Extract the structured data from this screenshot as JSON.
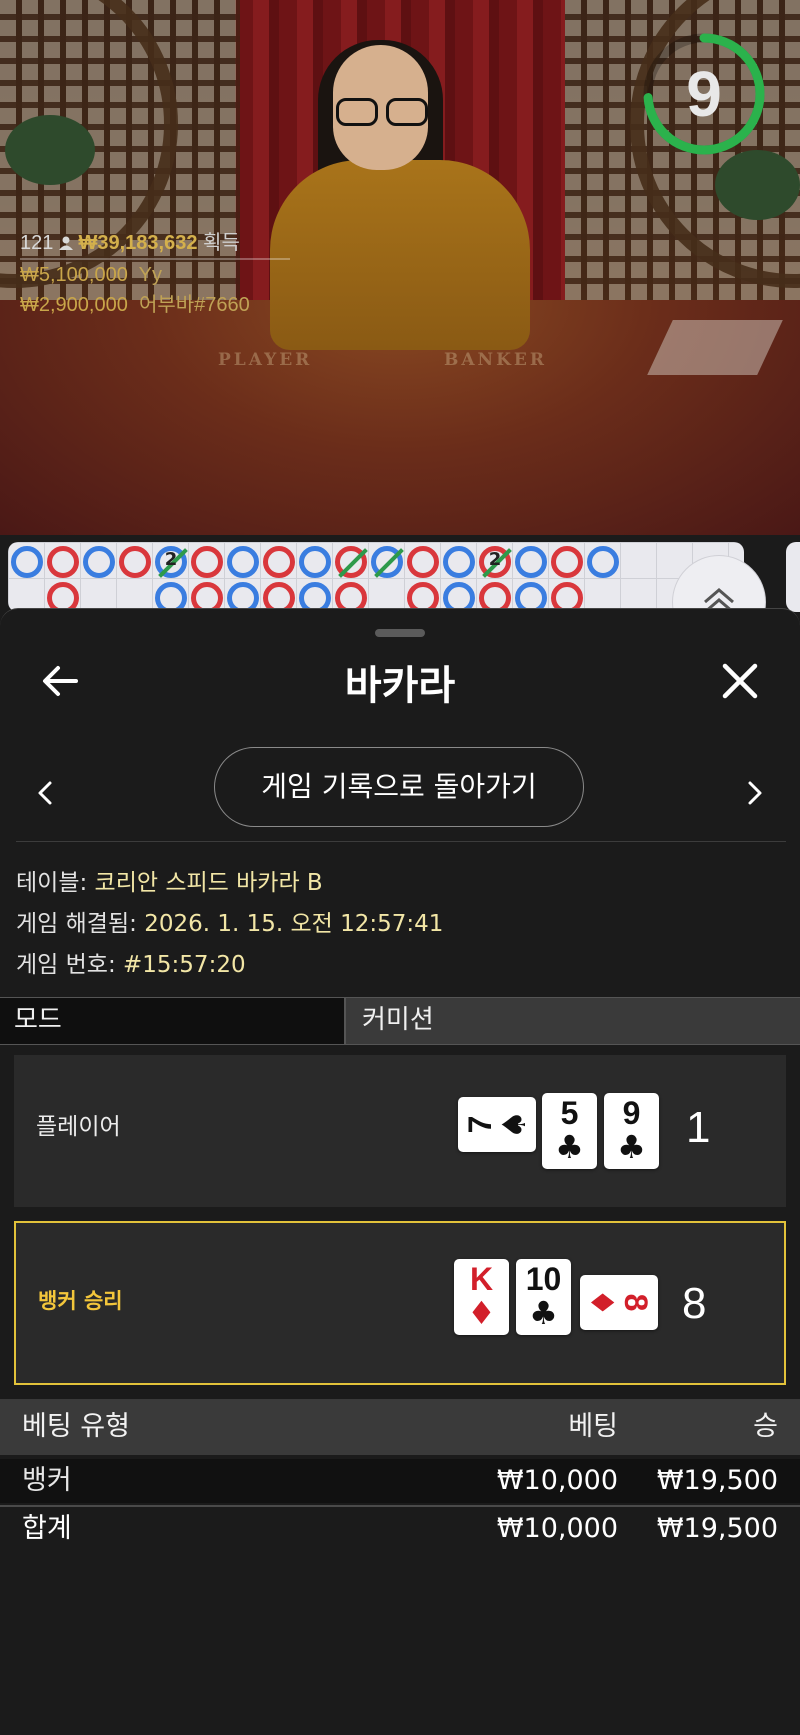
{
  "live": {
    "timer": "9",
    "timer_color": "#2bb24c",
    "winners": {
      "count": "121",
      "person_icon": "person-icon",
      "total_amount": "₩39,183,632",
      "total_label": "획득",
      "entries": [
        {
          "amount": "₩5,100,000",
          "user": "Yy"
        },
        {
          "amount": "₩2,900,000",
          "user": "어부바#7660"
        }
      ]
    },
    "table_labels": {
      "player": "PLAYER",
      "banker": "BANKER"
    }
  },
  "sheet": {
    "title": "바카라",
    "back_icon": "arrow-left-icon",
    "close_icon": "close-icon",
    "history_button": "게임 기록으로 돌아가기",
    "info": {
      "table_label": "테이블:",
      "table_value": "코리안 스피드 바카라 B",
      "resolved_label": "게임 해결됨:",
      "resolved_value": "2026. 1. 15. 오전 12:57:41",
      "number_label": "게임 번호:",
      "number_value": "#15:57:20"
    },
    "mode": {
      "label": "모드",
      "value": "커미션"
    },
    "player": {
      "label": "플레이어",
      "score": "1",
      "cards": [
        {
          "rank": "7",
          "suit": "♠",
          "color": "black",
          "orientation": "sideways"
        },
        {
          "rank": "5",
          "suit": "♣",
          "color": "black",
          "orientation": "upright"
        },
        {
          "rank": "9",
          "suit": "♣",
          "color": "black",
          "orientation": "upright"
        }
      ]
    },
    "banker": {
      "label": "뱅커 승리",
      "score": "8",
      "highlight_color": "#e2c23a",
      "cards": [
        {
          "rank": "K",
          "suit": "♦",
          "color": "red",
          "orientation": "upright"
        },
        {
          "rank": "10",
          "suit": "♣",
          "color": "black",
          "orientation": "upright"
        },
        {
          "rank": "8",
          "suit": "♦",
          "color": "red",
          "orientation": "sideways"
        }
      ]
    },
    "bets": {
      "headers": {
        "type": "베팅 유형",
        "bet": "베팅",
        "win": "승"
      },
      "rows": [
        {
          "type": "뱅커",
          "bet": "₩10,000",
          "win": "₩19,500"
        }
      ],
      "total": {
        "type": "합계",
        "bet": "₩10,000",
        "win": "₩19,500"
      }
    }
  },
  "roadmap": {
    "colors": {
      "banker": "#d9373c",
      "player": "#3a7de0",
      "tie": "#2e9a4b"
    },
    "expand_icon": "chevron-up-double-icon",
    "top_row": [
      {
        "side": "player",
        "tie": false
      },
      {
        "side": "banker",
        "tie": false
      },
      {
        "side": "player",
        "tie": false
      },
      {
        "side": "banker",
        "tie": false
      },
      {
        "side": "player",
        "tie": true,
        "tie_count": "2"
      },
      {
        "side": "banker",
        "tie": false
      },
      {
        "side": "player",
        "tie": false
      },
      {
        "side": "banker",
        "tie": false
      },
      {
        "side": "player",
        "tie": false
      },
      {
        "side": "banker",
        "tie": true
      },
      {
        "side": "player",
        "tie": true
      },
      {
        "side": "banker",
        "tie": false
      },
      {
        "side": "player",
        "tie": false
      },
      {
        "side": "banker",
        "tie": true,
        "tie_count": "2"
      },
      {
        "side": "player",
        "tie": false
      },
      {
        "side": "banker",
        "tie": false
      },
      {
        "side": "player",
        "tie": false
      }
    ],
    "bottom_row": [
      {
        "col": 1,
        "side": "banker"
      },
      {
        "col": 4,
        "side": "player"
      },
      {
        "col": 5,
        "side": "banker"
      },
      {
        "col": 6,
        "side": "player"
      },
      {
        "col": 7,
        "side": "banker"
      },
      {
        "col": 8,
        "side": "player"
      },
      {
        "col": 9,
        "side": "banker"
      },
      {
        "col": 11,
        "side": "banker"
      },
      {
        "col": 12,
        "side": "player"
      },
      {
        "col": 13,
        "side": "banker"
      },
      {
        "col": 14,
        "side": "player"
      },
      {
        "col": 15,
        "side": "banker"
      }
    ]
  }
}
